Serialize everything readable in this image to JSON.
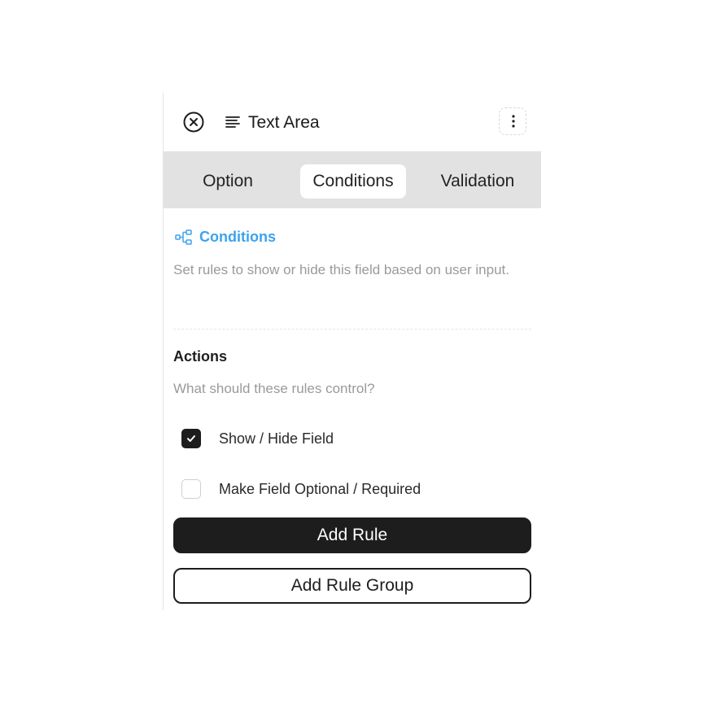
{
  "header": {
    "title": "Text Area",
    "close_icon": "close-circle-icon",
    "field_icon": "text-area-lines-icon",
    "more_icon": "vertical-ellipsis-icon"
  },
  "tabs": [
    {
      "label": "Option",
      "active": false
    },
    {
      "label": "Conditions",
      "active": true
    },
    {
      "label": "Validation",
      "active": false
    }
  ],
  "conditions": {
    "icon": "branch-flow-icon",
    "title": "Conditions",
    "description": "Set rules to show or hide this field based on user input.",
    "accent_color": "#3ba3ee"
  },
  "actions": {
    "title": "Actions",
    "description": "What should these rules control?",
    "options": [
      {
        "label": "Show / Hide Field",
        "checked": true
      },
      {
        "label": "Make Field Optional / Required",
        "checked": false
      }
    ]
  },
  "buttons": {
    "add_rule": "Add Rule",
    "add_rule_group": "Add Rule Group"
  }
}
